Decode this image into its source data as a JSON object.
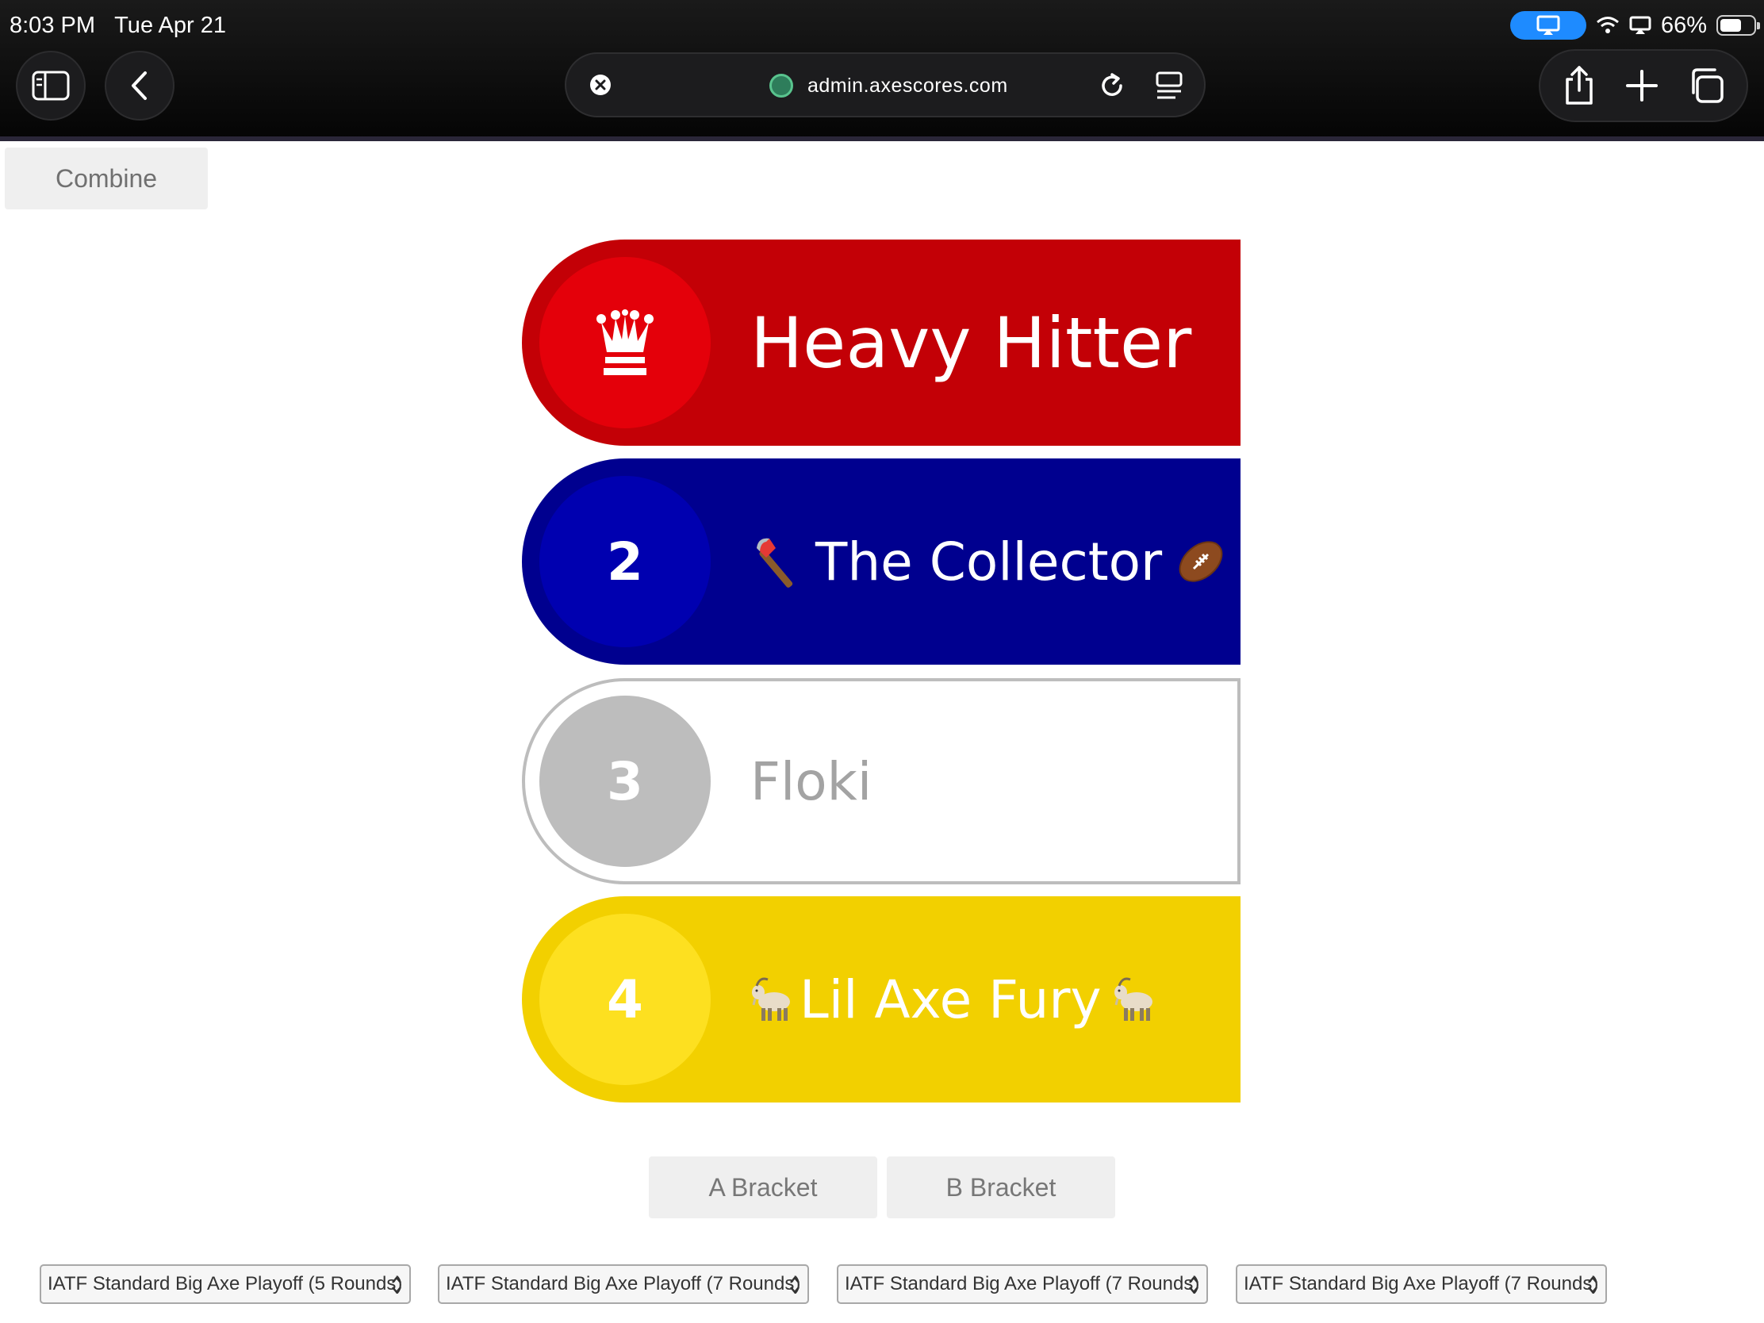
{
  "status_bar": {
    "time": "8:03 PM",
    "date": "Tue Apr 21",
    "battery": "66%",
    "battery_level": 0.66
  },
  "browser": {
    "domain": "admin.axescores.com"
  },
  "page": {
    "combine_label": "Combine",
    "standings": [
      {
        "rank": "",
        "badge_icon": "crown-icon",
        "name": "Heavy Hitter",
        "color": "#c30006",
        "badge_color": "#e4000a"
      },
      {
        "rank": "2",
        "name": "The Collector",
        "prefix_emoji": "axe-icon",
        "suffix_emoji": "football-icon",
        "color": "#00008f",
        "badge_color": "#0000b0"
      },
      {
        "rank": "3",
        "name": "Floki",
        "color": "#ffffff",
        "badge_color": "#bdbdbd",
        "text_color": "#a3a3a3"
      },
      {
        "rank": "4",
        "name": "Lil Axe Fury",
        "prefix_emoji": "goat-icon",
        "suffix_emoji": "goat-icon",
        "color": "#f2d000",
        "badge_color": "#fde020"
      }
    ],
    "brackets": {
      "a_label": "A Bracket",
      "b_label": "B Bracket"
    },
    "playoff_selects": [
      "IATF Standard Big Axe Playoff (5 Rounds)",
      "IATF Standard Big Axe Playoff (7 Rounds)",
      "IATF Standard Big Axe Playoff (7 Rounds)",
      "IATF Standard Big Axe Playoff (7 Rounds)"
    ]
  }
}
